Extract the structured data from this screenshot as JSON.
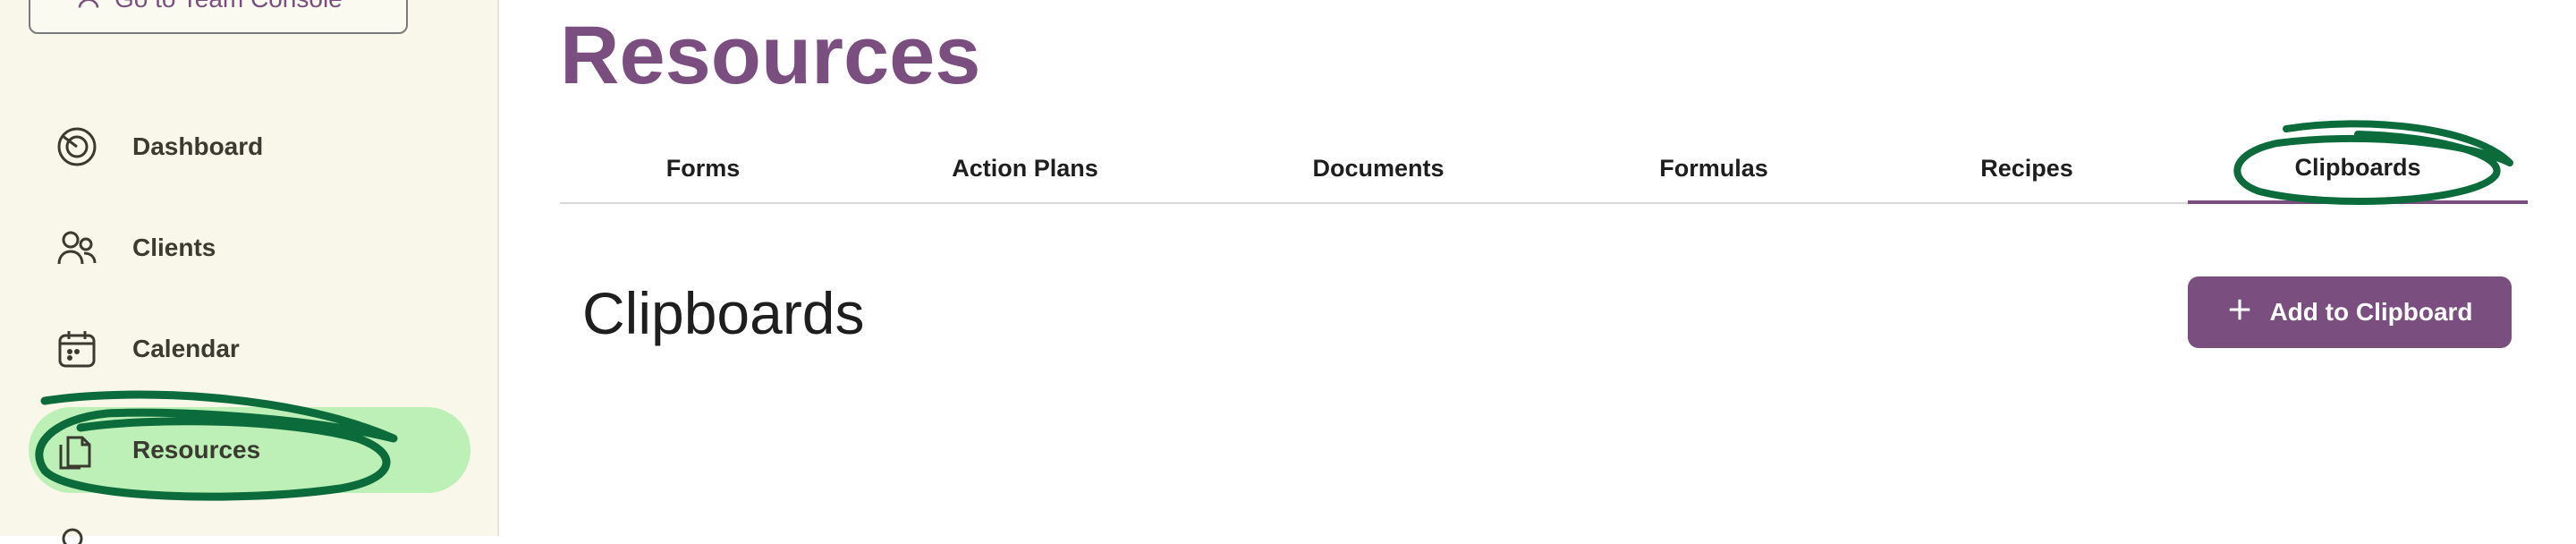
{
  "sidebar": {
    "team_console_label": "Go to Team Console",
    "items": [
      {
        "label": "Dashboard",
        "icon": "dashboard-icon"
      },
      {
        "label": "Clients",
        "icon": "clients-icon"
      },
      {
        "label": "Calendar",
        "icon": "calendar-icon"
      },
      {
        "label": "Resources",
        "icon": "resources-icon",
        "active": true
      }
    ]
  },
  "main": {
    "title": "Resources",
    "tabs": [
      {
        "label": "Forms"
      },
      {
        "label": "Action Plans"
      },
      {
        "label": "Documents"
      },
      {
        "label": "Formulas"
      },
      {
        "label": "Recipes"
      },
      {
        "label": "Clipboards",
        "active": true
      }
    ],
    "section_title": "Clipboards",
    "add_button_label": "Add to Clipboard"
  },
  "colors": {
    "brand_purple": "#7a4f80",
    "sidebar_bg": "#f8f7ea",
    "active_item_bg": "#bdf0b6",
    "annotation_green": "#0b6b3a"
  }
}
